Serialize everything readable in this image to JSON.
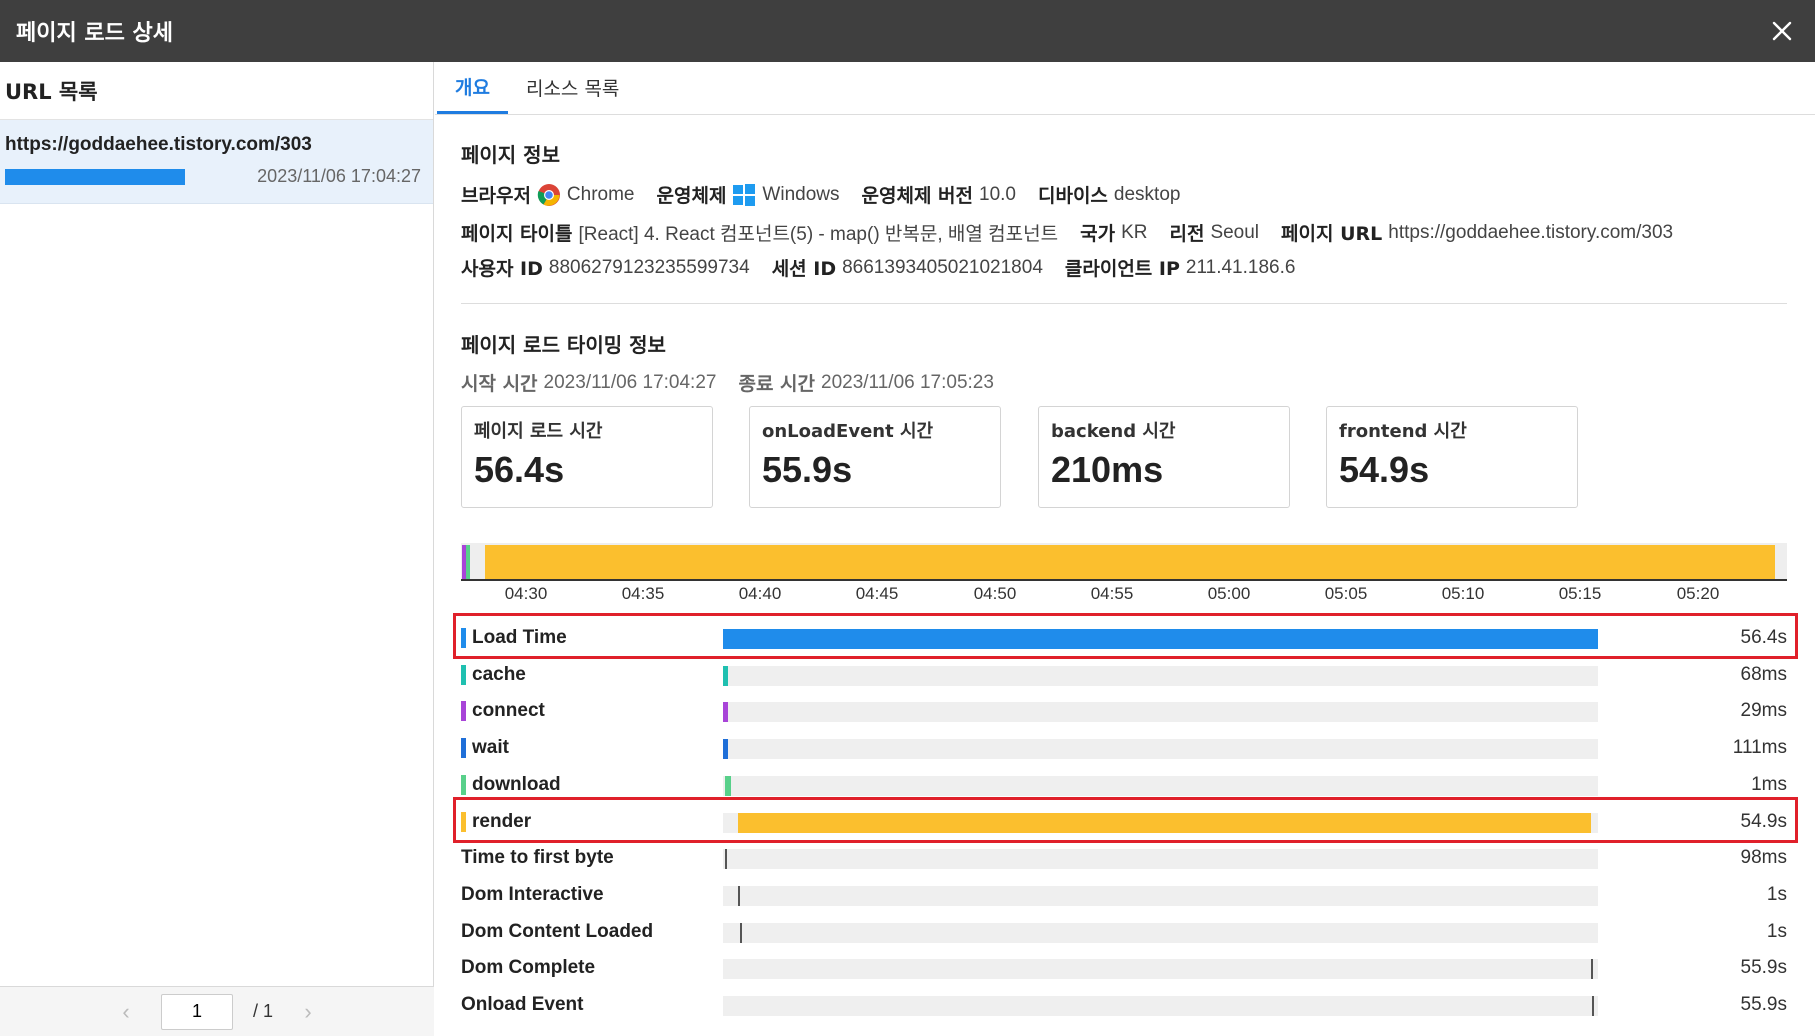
{
  "window": {
    "title": "페이지 로드 상세",
    "close_icon": "close-icon"
  },
  "sidebar": {
    "heading": "URL 목록",
    "items": [
      {
        "url": "https://goddaehee.tistory.com/303",
        "time": "2023/11/06 17:04:27"
      }
    ],
    "pager": {
      "current": "1",
      "total": "/ 1",
      "prev_icon": "chevron-left-icon",
      "next_icon": "chevron-right-icon"
    }
  },
  "tabs": [
    {
      "label": "개요",
      "active": true
    },
    {
      "label": "리소스 목록",
      "active": false
    }
  ],
  "page_info": {
    "title": "페이지 정보",
    "browser_k": "브라우저",
    "browser_v": "Chrome",
    "os_k": "운영체제",
    "os_v": "Windows",
    "osver_k": "운영체제 버전",
    "osver_v": "10.0",
    "device_k": "디바이스",
    "device_v": "desktop",
    "pagetitle_k": "페이지 타이틀",
    "pagetitle_v": "[React] 4. React 컴포넌트(5) - map() 반복문, 배열 컴포넌트",
    "country_k": "국가",
    "country_v": "KR",
    "region_k": "리전",
    "region_v": "Seoul",
    "pageurl_k": "페이지 URL",
    "pageurl_v": "https://goddaehee.tistory.com/303",
    "userid_k": "사용자 ID",
    "userid_v": "8806279123235599734",
    "session_k": "세션 ID",
    "session_v": "8661393405021021804",
    "ip_k": "클라이언트 IP",
    "ip_v": "211.41.186.6"
  },
  "timing": {
    "title": "페이지 로드 타이밍 정보",
    "start_k": "시작 시간",
    "start_v": "2023/11/06 17:04:27",
    "end_k": "종료 시간",
    "end_v": "2023/11/06 17:05:23",
    "cards": [
      {
        "label": "페이지 로드 시간",
        "value": "56.4s"
      },
      {
        "label": "onLoadEvent 시간",
        "value": "55.9s"
      },
      {
        "label": "backend 시간",
        "value": "210ms"
      },
      {
        "label": "frontend 시간",
        "value": "54.9s"
      }
    ],
    "timeline_ticks": [
      "04:30",
      "04:35",
      "04:40",
      "04:45",
      "04:50",
      "04:55",
      "05:00",
      "05:05",
      "05:10",
      "05:15",
      "05:20"
    ],
    "timeline_colors": {
      "render": "#fbbf2e",
      "connect": "#a844d8",
      "download": "#58d08a"
    },
    "metrics": [
      {
        "label": "Load Time",
        "value": "56.4s",
        "color": "#1f8ceb",
        "marker": true,
        "start": 0.0,
        "end": 1.0,
        "kind": "bar",
        "highlight": true
      },
      {
        "label": "cache",
        "value": "68ms",
        "color": "#1fc0b0",
        "marker": true,
        "start": 0.0,
        "end": 0.006,
        "kind": "bar"
      },
      {
        "label": "connect",
        "value": "29ms",
        "color": "#a844d8",
        "marker": true,
        "start": 0.0,
        "end": 0.006,
        "kind": "bar"
      },
      {
        "label": "wait",
        "value": "111ms",
        "color": "#1f6fd8",
        "marker": true,
        "start": 0.0,
        "end": 0.006,
        "kind": "bar"
      },
      {
        "label": "download",
        "value": "1ms",
        "color": "#58d08a",
        "marker": true,
        "start": 0.002,
        "end": 0.009,
        "kind": "bar"
      },
      {
        "label": "render",
        "value": "54.9s",
        "color": "#fbbf2e",
        "marker": true,
        "start": 0.017,
        "end": 0.992,
        "kind": "bar",
        "highlight": true
      },
      {
        "label": "Time to first byte",
        "value": "98ms",
        "color": "#555555",
        "marker": false,
        "start": 0.002,
        "kind": "tick"
      },
      {
        "label": "Dom Interactive",
        "value": "1s",
        "color": "#555555",
        "marker": false,
        "start": 0.017,
        "kind": "tick"
      },
      {
        "label": "Dom Content Loaded",
        "value": "1s",
        "color": "#555555",
        "marker": false,
        "start": 0.019,
        "kind": "tick"
      },
      {
        "label": "Dom Complete",
        "value": "55.9s",
        "color": "#555555",
        "marker": false,
        "start": 0.992,
        "kind": "tick"
      },
      {
        "label": "Onload Event",
        "value": "55.9s",
        "color": "#555555",
        "marker": false,
        "start": 0.993,
        "kind": "tick"
      }
    ]
  }
}
